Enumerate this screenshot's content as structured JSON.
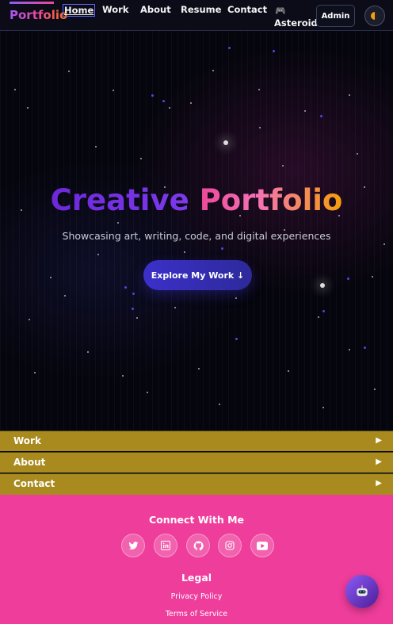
{
  "nav": {
    "brand": "Portfolio",
    "links": [
      {
        "label": "Home",
        "active": true
      },
      {
        "label": "Work"
      },
      {
        "label": "About"
      },
      {
        "label": "Resume"
      },
      {
        "label": "Contact"
      }
    ],
    "asteroids": {
      "icon": "gamepad-icon",
      "label": "Asteroids"
    },
    "admin_label": "Admin",
    "theme_toggle_icon": "half-moon-icon"
  },
  "hero": {
    "title_part1": "Creative",
    "title_part2": "Portfolio",
    "subtitle": "Showcasing art, writing, code, and digital experiences",
    "cta_label": "Explore My Work ↓"
  },
  "sections": [
    {
      "label": "Work",
      "arrow": "▶"
    },
    {
      "label": "About",
      "arrow": "▶"
    },
    {
      "label": "Contact",
      "arrow": "▶"
    }
  ],
  "footer": {
    "connect_heading": "Connect With Me",
    "social": [
      {
        "icon": "twitter-icon"
      },
      {
        "icon": "linkedin-icon"
      },
      {
        "icon": "github-icon"
      },
      {
        "icon": "instagram-icon"
      },
      {
        "icon": "youtube-icon"
      }
    ],
    "legal_heading": "Legal",
    "privacy_label": "Privacy Policy",
    "terms_label": "Terms of Service"
  },
  "chat_icon": "robot-icon",
  "colors": {
    "accordion": "#a98a1e",
    "footer": "#ef3d9c",
    "cta": "#3b30c9",
    "background": "#05050d"
  }
}
